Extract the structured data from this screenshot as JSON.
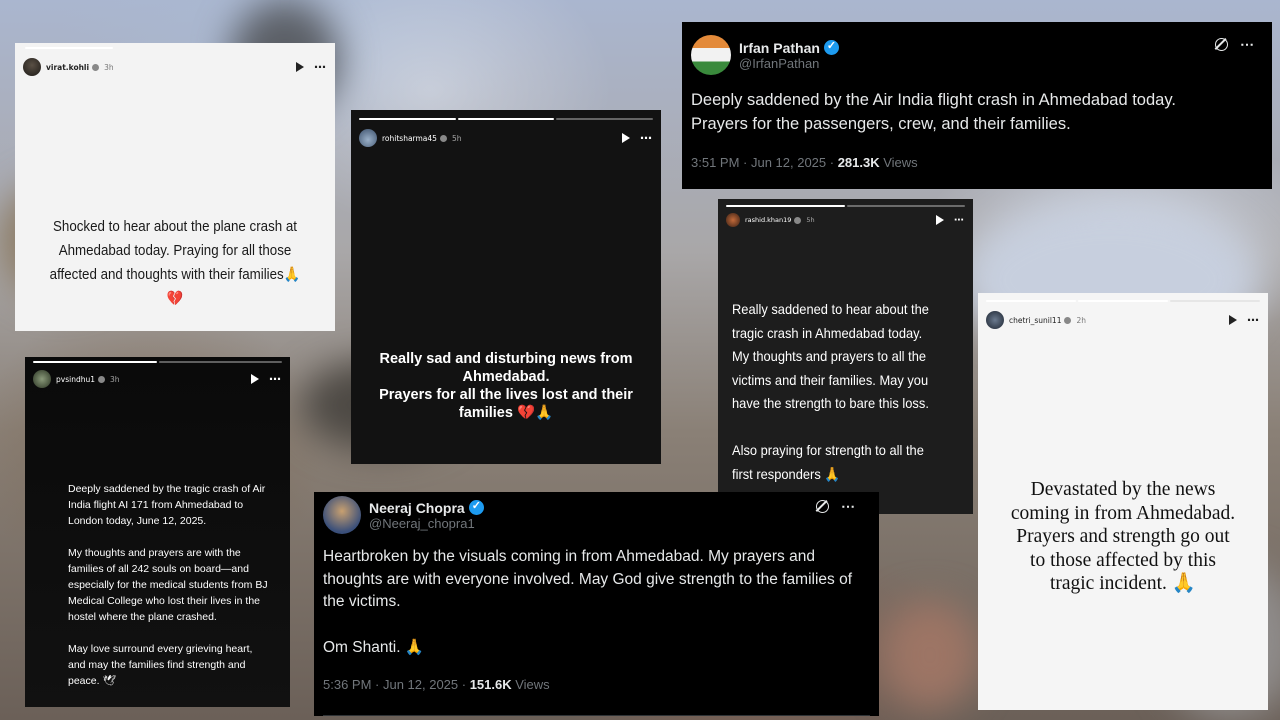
{
  "stories": {
    "kohli": {
      "user": "virat.kohli",
      "time": "3h",
      "text": "Shocked to hear about the plane crash at Ahmedabad today. Praying for all those affected and thoughts with their families🙏",
      "emoji": "💔"
    },
    "rohit": {
      "user": "rohitsharma45",
      "time": "5h",
      "text": "Really sad and disturbing news from Ahmedabad.\nPrayers for all the lives lost and their families 💔🙏"
    },
    "rashid": {
      "user": "rashid.khan19",
      "time": "5h",
      "text": "Really saddened to hear about the tragic crash in Ahmedabad today. My thoughts and prayers to all the victims and their families. May you have the strength to bare this loss.\n\nAlso praying for strength to all the first responders 🙏"
    },
    "chhetri": {
      "user": "chetri_sunil11",
      "time": "2h",
      "text": "Devastated by the news coming in from Ahmedabad. Prayers and strength go out to those affected by this tragic incident. 🙏"
    },
    "sindhu": {
      "user": "pvsindhu1",
      "time": "3h",
      "text": "Deeply saddened by the tragic crash of Air India flight AI 171 from Ahmedabad to London today, June 12, 2025.\n\nMy thoughts and prayers are with the families of all 242 souls on board—and especially for the medical students from BJ Medical College who lost their lives in the hostel where the plane crashed.\n\nMay love surround every grieving heart, and may the families find strength and peace. 🕊"
    }
  },
  "tweets": {
    "irfan": {
      "name": "Irfan Pathan",
      "handle": "@IrfanPathan",
      "text": "Deeply saddened by the Air India flight crash in Ahmedabad today. Prayers for the passengers, crew, and their families.",
      "time": "3:51 PM · Jun 12, 2025 · ",
      "views_count": "281.3K",
      "views_label": " Views"
    },
    "neeraj": {
      "name": "Neeraj Chopra",
      "handle": "@Neeraj_chopra1",
      "text": "Heartbroken by the visuals coming in from Ahmedabad. My prayers and thoughts are with everyone involved. May God give strength to the families of the victims.\n\nOm Shanti. 🙏",
      "time": "5:36 PM · Jun 12, 2025 · ",
      "views_count": "151.6K",
      "views_label": " Views"
    }
  },
  "icons": {
    "more": "⋯",
    "play": "play-icon",
    "grok": "grok-icon",
    "verified": "verified-badge-icon"
  }
}
